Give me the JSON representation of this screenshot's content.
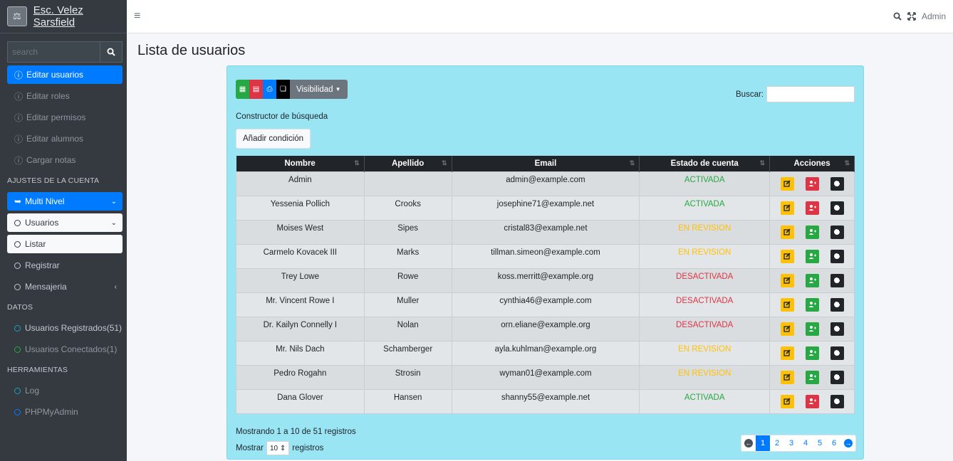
{
  "sidebar": {
    "brand": "Esc. Velez Sarsfield",
    "search_placeholder": "search",
    "items": [
      {
        "label": "Editar usuarios"
      },
      {
        "label": "Editar roles"
      },
      {
        "label": "Editar permisos"
      },
      {
        "label": "Editar alumnos"
      },
      {
        "label": "Cargar notas"
      }
    ],
    "section_account": "AJUSTES DE LA CUENTA",
    "multi_nivel": "Multi Nivel",
    "usuarios": "Usuarios",
    "listar": "Listar",
    "registrar": "Registrar",
    "mensajeria": "Mensajeria",
    "section_datos": "DATOS",
    "usuarios_registrados": "Usuarios Registrados(51)",
    "usuarios_conectados": "Usuarios Conectados(1)",
    "section_herramientas": "HERRAMIENTAS",
    "log": "Log",
    "phpmyadmin": "PHPMyAdmin"
  },
  "topbar": {
    "user": "Admin"
  },
  "page": {
    "title": "Lista de usuarios"
  },
  "toolbar": {
    "visibilidad": "Visibilidad",
    "buscar_label": "Buscar:",
    "builder_label": "Constructor de búsqueda",
    "add_condition": "Añadir condición"
  },
  "table": {
    "headers": [
      "Nombre",
      "Apellido",
      "Email",
      "Estado de cuenta",
      "Acciones"
    ],
    "rows": [
      {
        "nombre": "Admin",
        "apellido": "",
        "email": "admin@example.com",
        "estado": "ACTIVADA",
        "toggle": "del"
      },
      {
        "nombre": "Yessenia Pollich",
        "apellido": "Crooks",
        "email": "josephine71@example.net",
        "estado": "ACTIVADA",
        "toggle": "del"
      },
      {
        "nombre": "Moises West",
        "apellido": "Sipes",
        "email": "cristal83@example.net",
        "estado": "EN REVISION",
        "toggle": "ok"
      },
      {
        "nombre": "Carmelo Kovacek III",
        "apellido": "Marks",
        "email": "tillman.simeon@example.com",
        "estado": "EN REVISION",
        "toggle": "ok"
      },
      {
        "nombre": "Trey Lowe",
        "apellido": "Rowe",
        "email": "koss.merritt@example.org",
        "estado": "DESACTIVADA",
        "toggle": "ok"
      },
      {
        "nombre": "Mr. Vincent Rowe I",
        "apellido": "Muller",
        "email": "cynthia46@example.com",
        "estado": "DESACTIVADA",
        "toggle": "ok"
      },
      {
        "nombre": "Dr. Kailyn Connelly I",
        "apellido": "Nolan",
        "email": "orn.eliane@example.org",
        "estado": "DESACTIVADA",
        "toggle": "ok"
      },
      {
        "nombre": "Mr. Nils Dach",
        "apellido": "Schamberger",
        "email": "ayla.kuhlman@example.org",
        "estado": "EN REVISION",
        "toggle": "ok"
      },
      {
        "nombre": "Pedro Rogahn",
        "apellido": "Strosin",
        "email": "wyman01@example.com",
        "estado": "EN REVISION",
        "toggle": "ok"
      },
      {
        "nombre": "Dana Glover",
        "apellido": "Hansen",
        "email": "shanny55@example.net",
        "estado": "ACTIVADA",
        "toggle": "del"
      }
    ]
  },
  "status_colors": {
    "ACTIVADA": "#28a745",
    "EN REVISION": "#ffc107",
    "DESACTIVADA": "#dc3545"
  },
  "footer": {
    "info": "Mostrando 1 a 10 de 51 registros",
    "mostrar": "Mostrar",
    "page_size": "10",
    "registros": "registros",
    "pages": [
      "1",
      "2",
      "3",
      "4",
      "5",
      "6"
    ]
  }
}
